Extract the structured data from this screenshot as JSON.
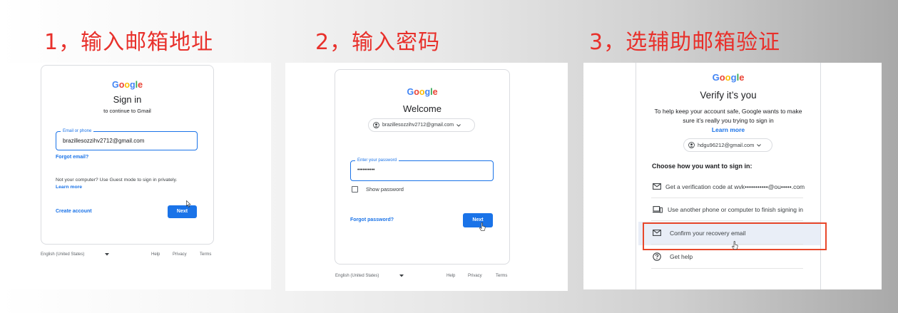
{
  "steps": [
    {
      "title": "1，输入邮箱地址"
    },
    {
      "title": "2，输入密码"
    },
    {
      "title": "3，选辅助邮箱验证"
    }
  ],
  "brand": "Google",
  "signin": {
    "heading": "Sign in",
    "subheading": "to continue to Gmail",
    "email_label": "Email or phone",
    "email_value": "brazillesozzihv2712@gmail.com",
    "forgot_email": "Forgot email?",
    "guest_text": "Not your computer? Use Guest mode to sign in privately.",
    "learn_more": "Learn more",
    "create_account": "Create account",
    "next": "Next",
    "language": "English (United States)",
    "help": "Help",
    "privacy": "Privacy",
    "terms": "Terms"
  },
  "password": {
    "heading": "Welcome",
    "account": "brazillesozzihv2712@gmail.com",
    "password_label": "Enter your password",
    "password_value": "••••••••••",
    "show_password": "Show password",
    "show_password_checked": false,
    "forgot_password": "Forgot password?",
    "next": "Next",
    "language": "English (United States)",
    "help": "Help",
    "privacy": "Privacy",
    "terms": "Terms"
  },
  "verify": {
    "heading": "Verify it’s you",
    "description": "To help keep your account safe, Google wants to make sure it’s really you trying to sign in",
    "learn_more": "Learn more",
    "account": "hdgu96212@gmail.com",
    "choose_label": "Choose how you want to sign in:",
    "options": [
      {
        "icon": "mail-icon",
        "label": "Get a verification code at wvk•••••••••••@ou•••••.com"
      },
      {
        "icon": "devices-icon",
        "label": "Use another phone or computer to finish signing in"
      },
      {
        "icon": "mail-icon",
        "label": "Confirm your recovery email"
      },
      {
        "icon": "help-icon",
        "label": "Get help"
      }
    ],
    "highlight_color": "#e8472a"
  },
  "colors": {
    "step_title": "#e8302b",
    "primary": "#1a73e8"
  }
}
